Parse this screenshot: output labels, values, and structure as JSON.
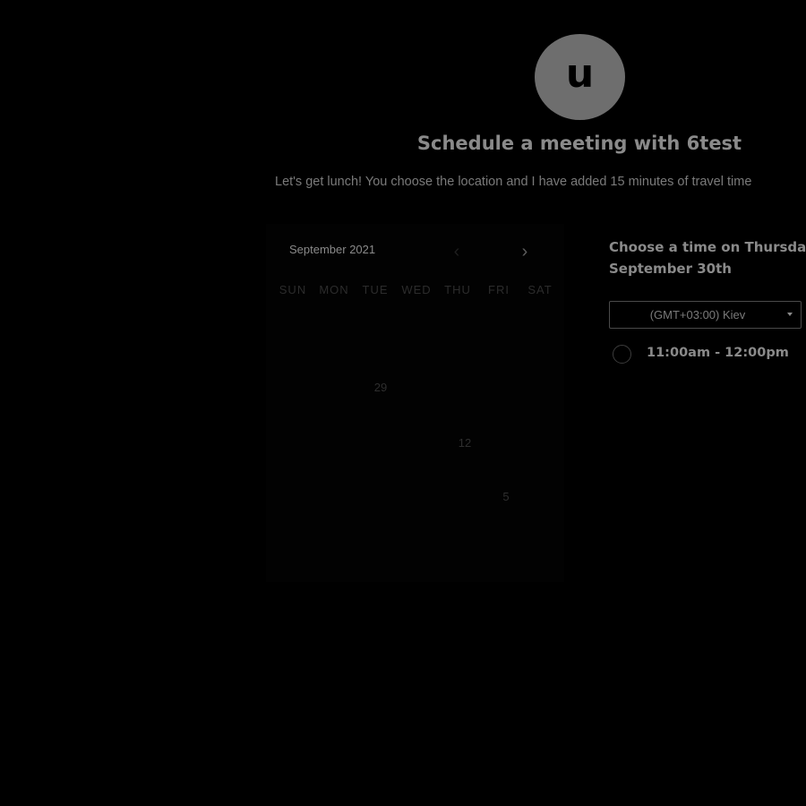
{
  "host": {
    "avatar_letter": "u",
    "title": "Schedule a meeting with 6test",
    "description": "Let's get lunch! You choose the location and I have added 15 minutes of travel time"
  },
  "calendar": {
    "month_label": "September 2021",
    "prev_icon": "chevron-left-icon",
    "next_icon": "chevron-right-icon",
    "prev_glyph": "‹",
    "next_glyph": "›",
    "weekdays": [
      "SUN",
      "MON",
      "TUE",
      "WED",
      "THU",
      "FRI",
      "SAT"
    ],
    "visible_days": {
      "d1": "29",
      "d2": "12",
      "d3": "5"
    }
  },
  "times": {
    "heading_line1": "Choose a time on Thursday,",
    "heading_line2": "September 30th",
    "timezone": "(GMT+03:00) Kiev",
    "slots": [
      {
        "label": "11:00am - 12:00pm"
      }
    ]
  },
  "colors": {
    "background": "#000000",
    "avatar": "#6e6e6e",
    "text": "#8a8a8a"
  }
}
